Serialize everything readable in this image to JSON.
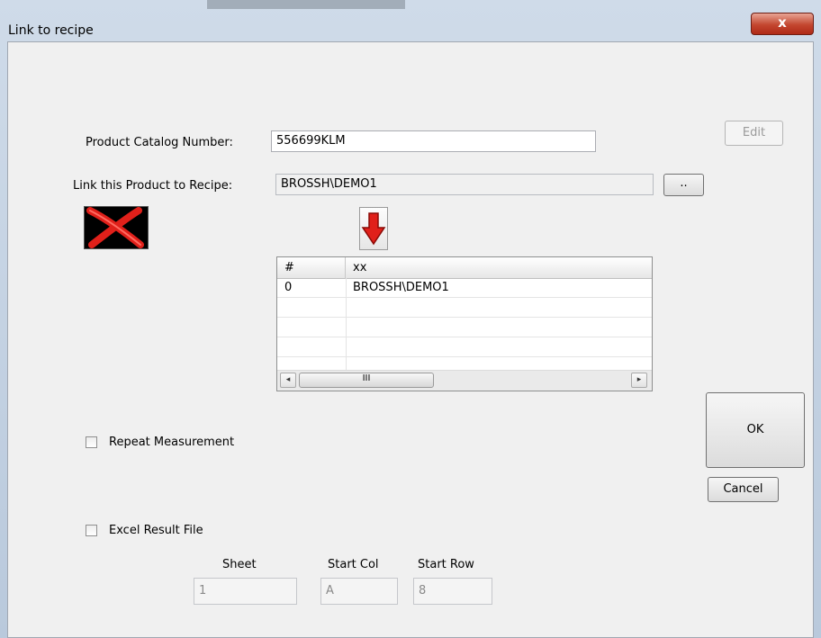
{
  "window": {
    "title": "Link to recipe",
    "close_label": "x"
  },
  "form": {
    "catalog_label": "Product Catalog Number:",
    "catalog_value": "556699KLM",
    "recipe_label": "Link this Product to Recipe:",
    "recipe_value": "BROSSH\\DEMO1",
    "browse_label": "..",
    "edit_label": "Edit"
  },
  "grid": {
    "columns": [
      "#",
      "xx"
    ],
    "rows": [
      {
        "index": "0",
        "value": "BROSSH\\DEMO1"
      }
    ],
    "scroll_left": "◂",
    "scroll_thumb": "III",
    "scroll_right": "▸"
  },
  "options": {
    "repeat_label": "Repeat Measurement",
    "repeat_checked": false,
    "excel_label": "Excel Result File",
    "excel_checked": false
  },
  "excel": {
    "sheet_label": "Sheet",
    "sheet_value": "1",
    "start_col_label": "Start Col",
    "start_col_value": "A",
    "start_row_label": "Start Row",
    "start_row_value": "8"
  },
  "actions": {
    "ok_label": "OK",
    "cancel_label": "Cancel"
  },
  "icons": {
    "delete": "red-x-icon",
    "add": "red-down-arrow-icon"
  },
  "colors": {
    "close_red": "#c3462f",
    "icon_red": "#e0201a"
  }
}
